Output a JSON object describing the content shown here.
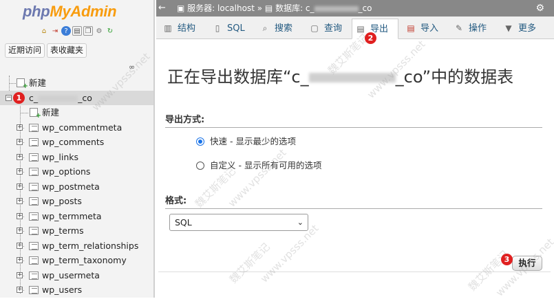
{
  "logo": {
    "php": "php",
    "my_admin": "MyAdmin"
  },
  "nav": {
    "recent_button": "近期访问",
    "favorites_button": "表收藏夹",
    "tree_new": "新建",
    "database": {
      "prefix": "c_",
      "suffix": "_co"
    },
    "db_new": "新建",
    "tables": [
      "wp_commentmeta",
      "wp_comments",
      "wp_links",
      "wp_options",
      "wp_postmeta",
      "wp_posts",
      "wp_termmeta",
      "wp_terms",
      "wp_term_relationships",
      "wp_term_taxonomy",
      "wp_usermeta",
      "wp_users"
    ]
  },
  "breadcrumb": {
    "server": "服务器: localhost »",
    "database": "数据库: c_",
    "database_suffix": "_co"
  },
  "tabs": [
    {
      "label": "结构",
      "icon": "structure-icon"
    },
    {
      "label": "SQL",
      "icon": "sql-icon"
    },
    {
      "label": "搜索",
      "icon": "search-icon"
    },
    {
      "label": "查询",
      "icon": "query-icon"
    },
    {
      "label": "导出",
      "icon": "export-icon",
      "active": true
    },
    {
      "label": "导入",
      "icon": "import-icon"
    },
    {
      "label": "操作",
      "icon": "wrench-icon"
    },
    {
      "label": "更多",
      "icon": "chevron-down-icon"
    }
  ],
  "main": {
    "title_before": "正在导出数据库“c_",
    "title_after": "_co”中的数据表",
    "export_method_heading": "导出方式:",
    "quick_option": "快速 - 显示最少的选项",
    "custom_option": "自定义 - 显示所有可用的选项",
    "format_heading": "格式:",
    "format_selected": "SQL",
    "go_button": "执行"
  },
  "markers": [
    "1",
    "2",
    "3"
  ],
  "watermark": {
    "cn": "魏艾斯笔记",
    "url": "www.vpsss.net"
  },
  "colors": {
    "marker": "#e02020",
    "radio_selected": "#1a73e8",
    "link": "#235a81",
    "logo_php": "#6c78af",
    "logo_myadmin": "#f89c0e"
  }
}
